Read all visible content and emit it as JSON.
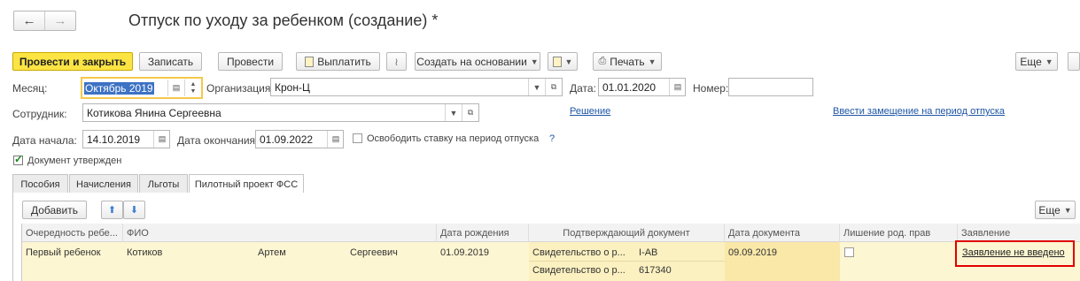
{
  "window": {
    "title": "Отпуск по уходу за ребенком (создание) *"
  },
  "toolbar": {
    "post_close": "Провести и закрыть",
    "save": "Записать",
    "post": "Провести",
    "pay": "Выплатить",
    "create_based": "Создать на основании",
    "print": "Печать",
    "more": "Еще"
  },
  "form": {
    "month_label": "Месяц:",
    "month_value": "Октябрь 2019",
    "org_label": "Организация:",
    "org_value": "Крон-Ц",
    "date_label": "Дата:",
    "date_value": "01.01.2020",
    "number_label": "Номер:",
    "number_value": "",
    "employee_label": "Сотрудник:",
    "employee_value": "Котикова Янина Сергеевна",
    "start_label": "Дата начала:",
    "start_value": "14.10.2019",
    "end_label": "Дата окончания:",
    "end_value": "01.09.2022",
    "free_rate_label": "Освободить ставку на период отпуска",
    "help": "?",
    "approved_label": "Документ утвержден",
    "approved": true,
    "decision_link": "Решение",
    "replacement_link": "Ввести замещение на период отпуска"
  },
  "tabs": [
    "Пособия",
    "Начисления",
    "Льготы",
    "Пилотный проект ФСС"
  ],
  "active_tab": 3,
  "table_toolbar": {
    "add": "Добавить",
    "more": "Еще"
  },
  "table": {
    "headers": [
      "Очередность ребе...",
      "ФИО",
      "Дата рождения",
      "Подтверждающий документ",
      "Дата документа",
      "Лишение род. прав",
      "Заявление"
    ],
    "row": {
      "order": "Первый ребенок",
      "last_name": "Котиков",
      "first_name": "Артем",
      "patronymic": "Сергеевич",
      "birth_date": "01.09.2019",
      "doc_type_1": "Свидетельство о р...",
      "doc_series": "I-АВ",
      "doc_type_2": "Свидетельство о р...",
      "doc_number": "617340",
      "doc_date": "09.09.2019",
      "deprivation": false,
      "application_link": "Заявление не введено"
    }
  },
  "colors": {
    "primary_button": "#fbe443",
    "row_highlight": "#fdf6d2",
    "link": "#1d56a5",
    "annotation_box": "#e00000"
  }
}
